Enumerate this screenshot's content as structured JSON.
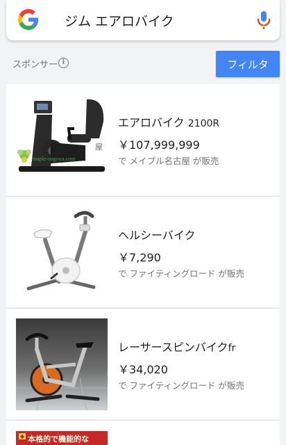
{
  "search": {
    "query": "ジム エアロバイク"
  },
  "ads": {
    "sponsor_label": "スポンサー",
    "filter_label": "フィルタ"
  },
  "products": [
    {
      "title": "エアロバイク",
      "title_suffix": "2100R",
      "price": "￥107,999,999",
      "seller": "で メイプル名古屋 が販売",
      "watermark": "maple-nagoya.com"
    },
    {
      "title": "ヘルシーバイク",
      "title_suffix": "",
      "price": "￥7,290",
      "seller": "で ファイティングロード が販売"
    },
    {
      "title": "レーサースピンバイク",
      "title_suffix": "fr",
      "price": "￥34,020",
      "seller": "で ファイティングロード が販売"
    }
  ],
  "partial_product": {
    "banner_text": "本格的で機能的な"
  },
  "colors": {
    "accent": "#4285f4",
    "page_bg": "#f1f3f4"
  }
}
